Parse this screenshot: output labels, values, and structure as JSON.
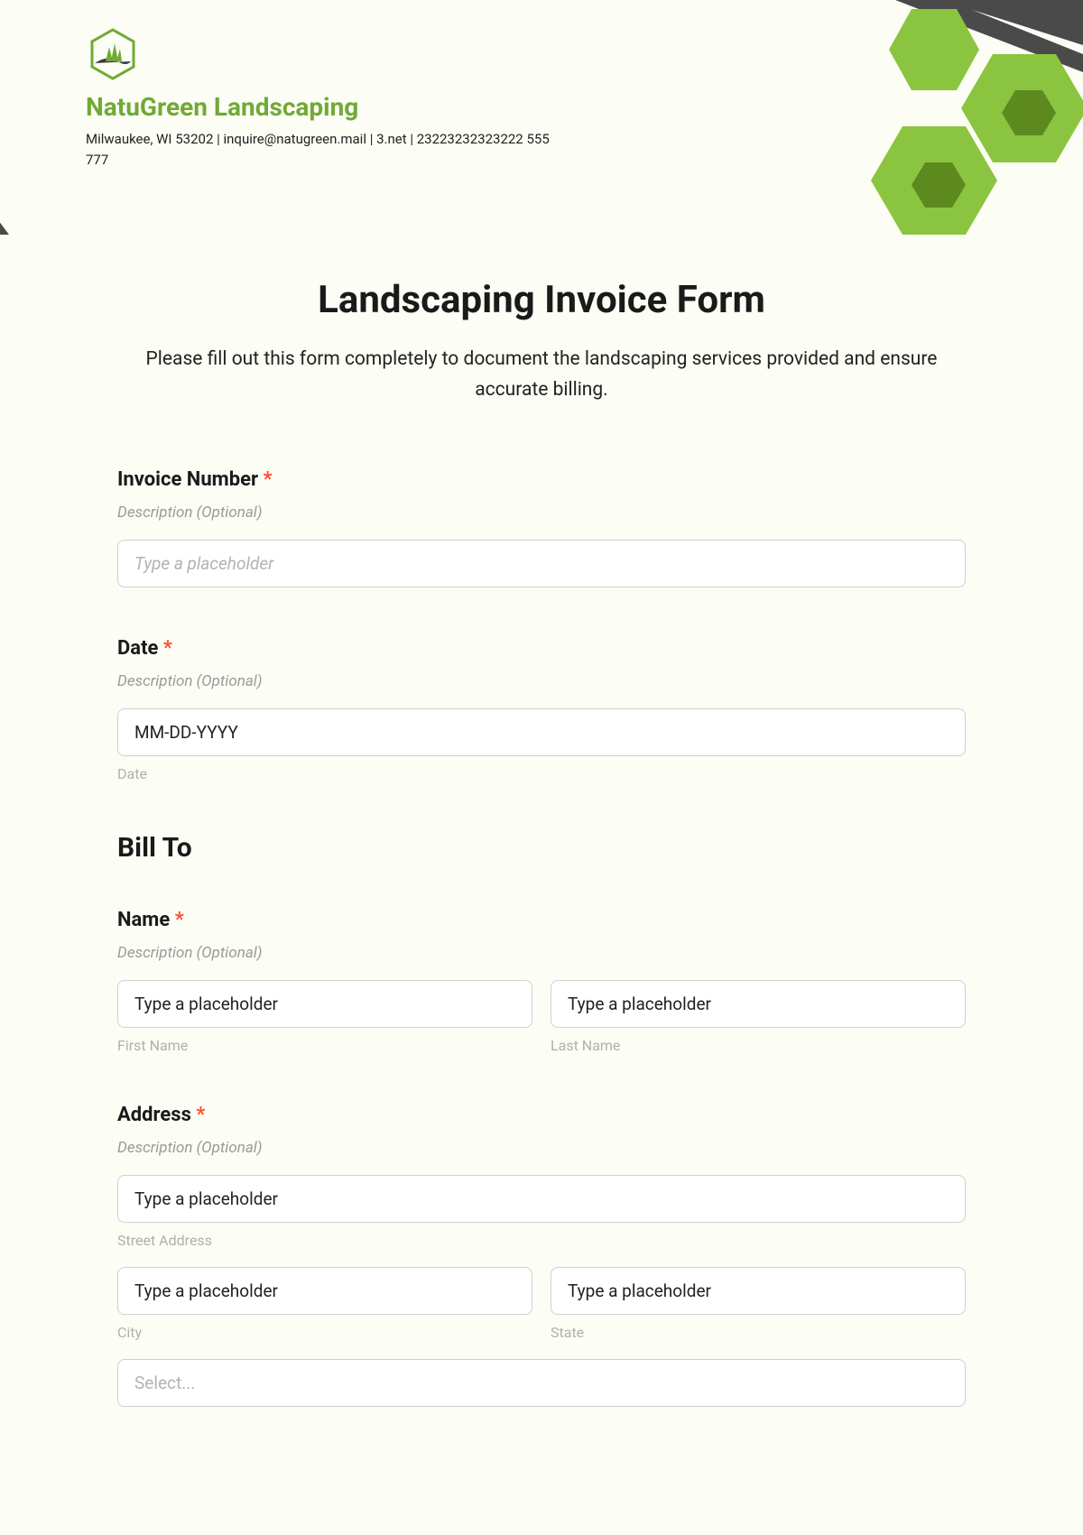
{
  "company": {
    "name": "NatuGreen Landscaping",
    "contact": "Milwaukee, WI 53202 | inquire@natugreen.mail | 3.net | 23223232323222 555 777"
  },
  "form": {
    "title": "Landscaping Invoice Form",
    "subtitle": "Please fill out this form completely to document the landscaping services provided and ensure accurate billing."
  },
  "fields": {
    "invoice": {
      "label": "Invoice Number",
      "desc": "Description (Optional)",
      "placeholder": "Type a placeholder"
    },
    "date": {
      "label": "Date",
      "desc": "Description (Optional)",
      "placeholder": "MM-DD-YYYY",
      "sublabel": "Date"
    },
    "billto_heading": "Bill To",
    "name": {
      "label": "Name",
      "desc": "Description (Optional)",
      "first_placeholder": "Type a placeholder",
      "last_placeholder": "Type a placeholder",
      "first_sublabel": "First Name",
      "last_sublabel": "Last Name"
    },
    "address": {
      "label": "Address",
      "desc": "Description (Optional)",
      "street_placeholder": "Type a placeholder",
      "street_sublabel": "Street Address",
      "city_placeholder": "Type a placeholder",
      "city_sublabel": "City",
      "state_placeholder": "Type a placeholder",
      "state_sublabel": "State",
      "select_placeholder": "Select..."
    }
  }
}
